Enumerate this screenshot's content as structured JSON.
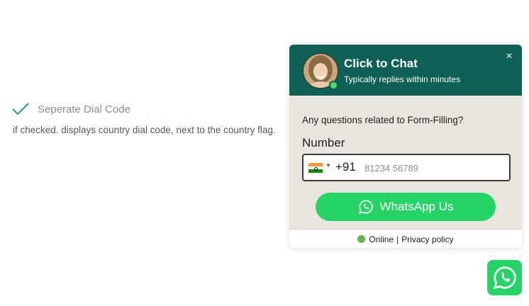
{
  "setting": {
    "label": "Seperate Dial Code",
    "description": "if checked. displays country dial code, next to the country flag.",
    "checked": true
  },
  "chat": {
    "title": "Click to Chat",
    "subtitle": "Typically replies within minutes",
    "close_icon": "×",
    "question": "Any questions related to Form-Filling?",
    "field_label": "Number",
    "dial_code": "+91",
    "phone_placeholder": "81234 56789",
    "phone_value": "",
    "button_label": "WhatsApp Us",
    "footer_status": "Online",
    "footer_separator": "|",
    "footer_link": "Privacy policy"
  },
  "colors": {
    "header": "#0e5f54",
    "whatsapp_green": "#25d366",
    "online_green": "#6ab04c",
    "body_bg": "#e9e4dc"
  },
  "icons": [
    "checkmark-icon",
    "close-icon",
    "whatsapp-icon",
    "india-flag-icon",
    "caret-down-icon"
  ]
}
